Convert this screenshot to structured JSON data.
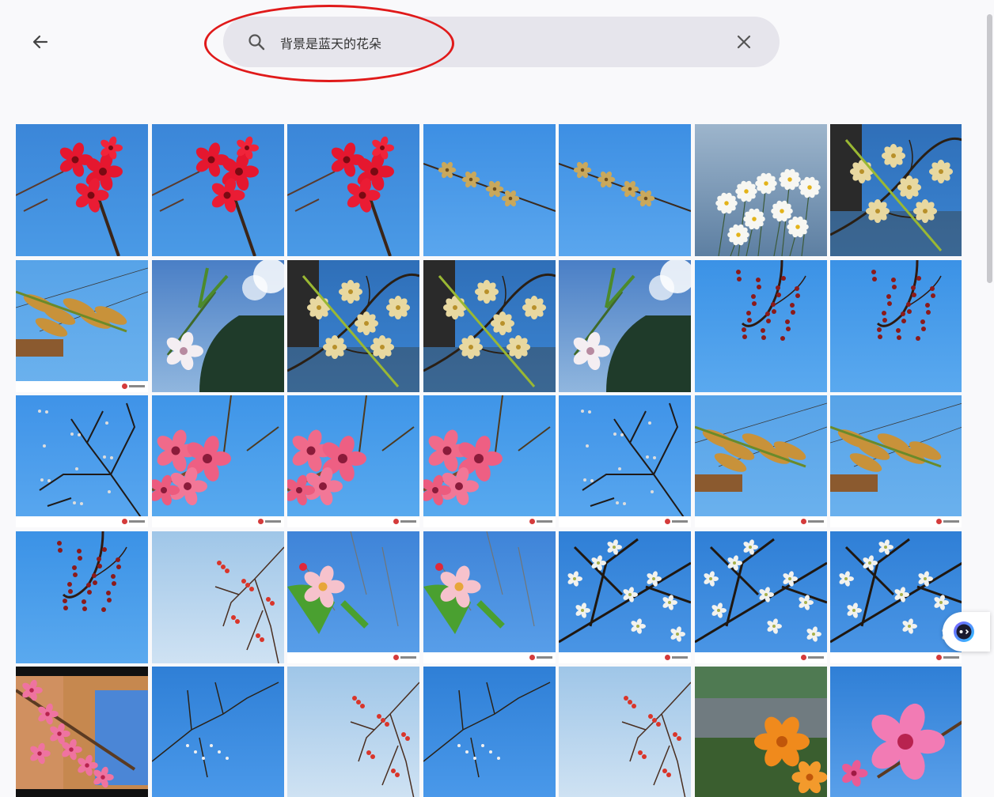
{
  "search": {
    "query": "背景是蓝天的花朵",
    "placeholder": ""
  },
  "icons": {
    "back": "arrow-back-icon",
    "search": "search-icon",
    "clear": "close-icon",
    "assistant": "assistant-icon"
  },
  "colors": {
    "search_bg": "#e6e5ec",
    "highlight_circle": "#e01a1a",
    "sky": "#3d93e8",
    "page_bg": "#f9f9fb"
  },
  "results": [
    {
      "theme": "red-blossom"
    },
    {
      "theme": "red-blossom"
    },
    {
      "theme": "red-blossom"
    },
    {
      "theme": "branch-buds"
    },
    {
      "theme": "branch-buds"
    },
    {
      "theme": "daisies"
    },
    {
      "theme": "yellow-blossom-dark"
    },
    {
      "theme": "catkins"
    },
    {
      "theme": "white-blossom-tree"
    },
    {
      "theme": "yellow-blossom-dark"
    },
    {
      "theme": "yellow-blossom-dark"
    },
    {
      "theme": "white-blossom-tree"
    },
    {
      "theme": "red-berries"
    },
    {
      "theme": "red-berries"
    },
    {
      "theme": "bare-tree"
    },
    {
      "theme": "pink-blossom"
    },
    {
      "theme": "pink-blossom"
    },
    {
      "theme": "pink-blossom"
    },
    {
      "theme": "bare-tree"
    },
    {
      "theme": "catkins"
    },
    {
      "theme": "catkins"
    },
    {
      "theme": "red-berries"
    },
    {
      "theme": "pale-sky-tree"
    },
    {
      "theme": "apple-blossom"
    },
    {
      "theme": "apple-blossom"
    },
    {
      "theme": "white-flowers-branch"
    },
    {
      "theme": "white-flowers-branch"
    },
    {
      "theme": "white-flowers-branch"
    },
    {
      "theme": "film-pink"
    },
    {
      "theme": "thin-branch"
    },
    {
      "theme": "pale-sky-tree"
    },
    {
      "theme": "thin-branch"
    },
    {
      "theme": "pale-sky-tree"
    },
    {
      "theme": "orange-lily"
    },
    {
      "theme": "pink-big-flower"
    }
  ]
}
